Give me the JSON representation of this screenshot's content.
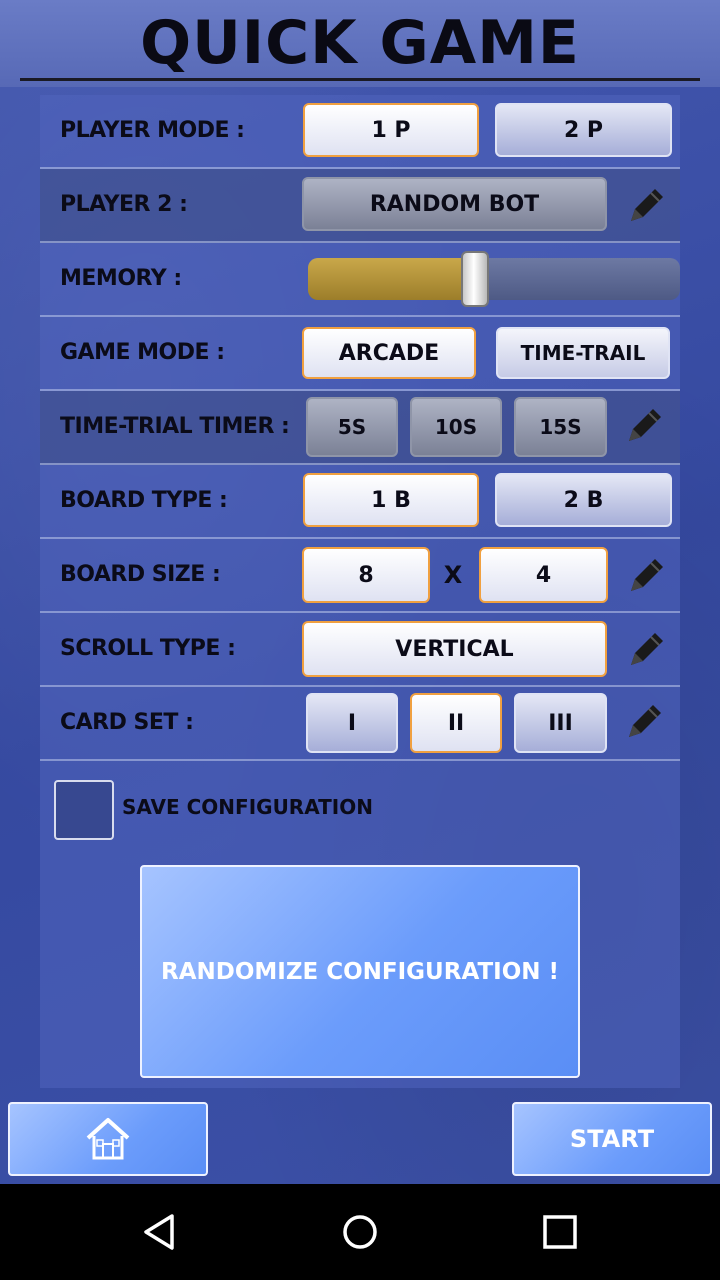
{
  "header": {
    "title": "QUICK GAME"
  },
  "rows": {
    "player_mode": {
      "label": "PLAYER MODE :",
      "options": [
        "1 P",
        "2 P"
      ],
      "selected": "1 P"
    },
    "player2": {
      "label": "PLAYER 2 :",
      "value": "RANDOM BOT"
    },
    "memory": {
      "label": "MEMORY :",
      "level": 0.45
    },
    "game_mode": {
      "label": "GAME MODE :",
      "options": [
        "ARCADE",
        "TIME-TRAIL"
      ],
      "selected": "ARCADE"
    },
    "time_trial_timer": {
      "label": "TIME-TRIAL TIMER :",
      "options": [
        "5S",
        "10S",
        "15S"
      ]
    },
    "board_type": {
      "label": "BOARD TYPE :",
      "options": [
        "1 B",
        "2 B"
      ],
      "selected": "1 B"
    },
    "board_size": {
      "label": "BOARD SIZE :",
      "width": "8",
      "separator": "X",
      "height": "4"
    },
    "scroll_type": {
      "label": "SCROLL TYPE :",
      "value": "VERTICAL"
    },
    "card_set": {
      "label": "CARD SET  :",
      "options": [
        "I",
        "II",
        "III"
      ],
      "selected": "II"
    }
  },
  "save_configuration": {
    "label": "SAVE CONFIGURATION",
    "checked": false
  },
  "randomize": {
    "label": "RANDOMIZE CONFIGURATION !"
  },
  "footer": {
    "home_icon": "home-icon",
    "start_label": "START"
  },
  "navbar": {
    "icons": [
      "back-icon",
      "home-circle-icon",
      "recents-icon"
    ]
  },
  "colors": {
    "accent_selected_border": "#f0a040",
    "action_button": "#6b9cfb",
    "slider_fill": "#b8963a"
  }
}
